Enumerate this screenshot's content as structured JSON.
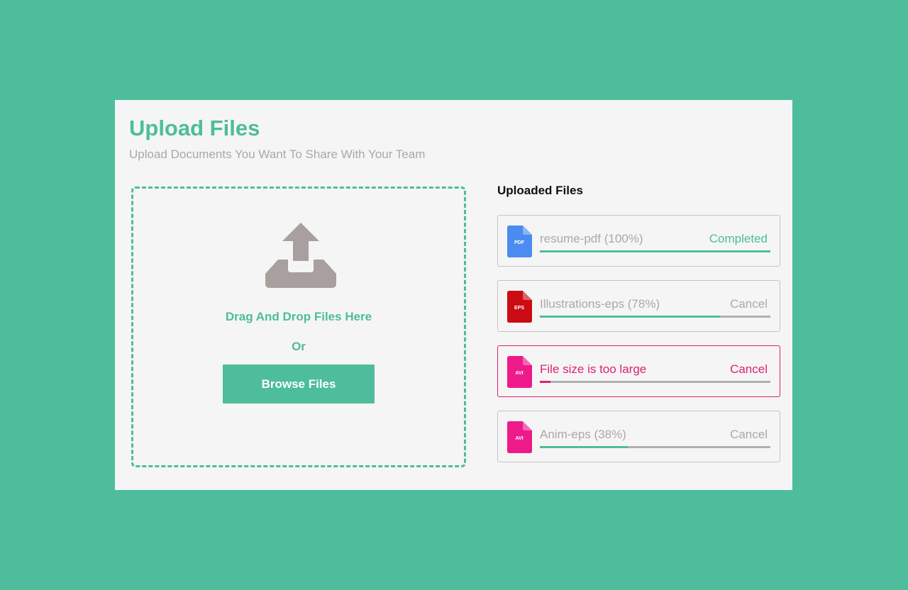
{
  "header": {
    "title": "Upload Files",
    "subtitle": "Upload Documents You Want To Share With Your Team"
  },
  "dropzone": {
    "drag_text": "Drag And Drop Files Here",
    "or_text": "Or",
    "browse_label": "Browse Files",
    "icon": "upload-tray-icon"
  },
  "files_list": {
    "heading": "Uploaded Files",
    "items": [
      {
        "type_label": "PDF",
        "icon_color": "#4b8cf0",
        "name": "resume-pdf (100%)",
        "action": "Completed",
        "progress": 1.0,
        "status": "completed"
      },
      {
        "type_label": "EPS",
        "icon_color": "#cc0c14",
        "name": "Illustrations-eps (78%)",
        "action": "Cancel",
        "progress": 0.78,
        "status": "uploading"
      },
      {
        "type_label": "AVI",
        "icon_color": "#ee1a8a",
        "name": "File size is too large",
        "action": "Cancel",
        "progress": 0.045,
        "status": "error"
      },
      {
        "type_label": "AVI",
        "icon_color": "#ee1a8a",
        "name": "Anim-eps (38%)",
        "action": "Cancel",
        "progress": 0.38,
        "status": "uploading"
      }
    ]
  },
  "colors": {
    "accent": "#4dbd9b",
    "error": "#e01e74",
    "muted_text": "#a9a9a9",
    "icon_gray": "#a8a09f"
  }
}
